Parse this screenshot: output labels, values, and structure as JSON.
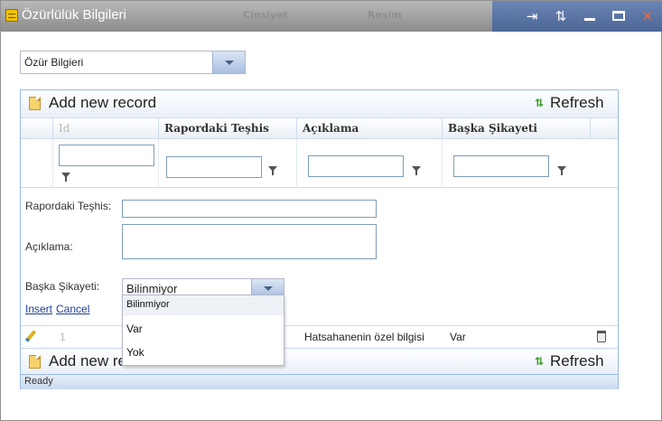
{
  "window": {
    "title": "Özürlülük Bilgileri",
    "faded_headers": [
      "Cinsiyet",
      "Resim"
    ],
    "controls": {
      "pin": "⇥",
      "refresh": "⇅",
      "close": "✕"
    }
  },
  "top_select": {
    "value": "Özür Bilgieri"
  },
  "grid": {
    "add_label": "Add new record",
    "refresh_label": "Refresh",
    "columns": [
      {
        "label": "Id"
      },
      {
        "label": "Rapordaki Teşhis"
      },
      {
        "label": "Açıklama"
      },
      {
        "label": "Başka Şikayeti"
      }
    ],
    "form": {
      "diagnosis_label": "Rapordaki Teşhis:",
      "description_label": "Açıklama:",
      "other_label": "Başka Şikayeti:",
      "other_value": "Bilinmiyor",
      "insert_link": "Insert",
      "cancel_link": "Cancel"
    },
    "row": {
      "id": "1",
      "description": "Hatsahanenin özel bilgisi",
      "other": "Var"
    },
    "status": "Ready"
  },
  "dropdown": {
    "options": [
      "Bilinmiyor",
      "Var",
      "Yok"
    ],
    "selected": "Bilinmiyor"
  },
  "colors": {
    "titlebar": "#9a9a9a",
    "accent": "#99bbe8",
    "link": "#1c3f94"
  }
}
